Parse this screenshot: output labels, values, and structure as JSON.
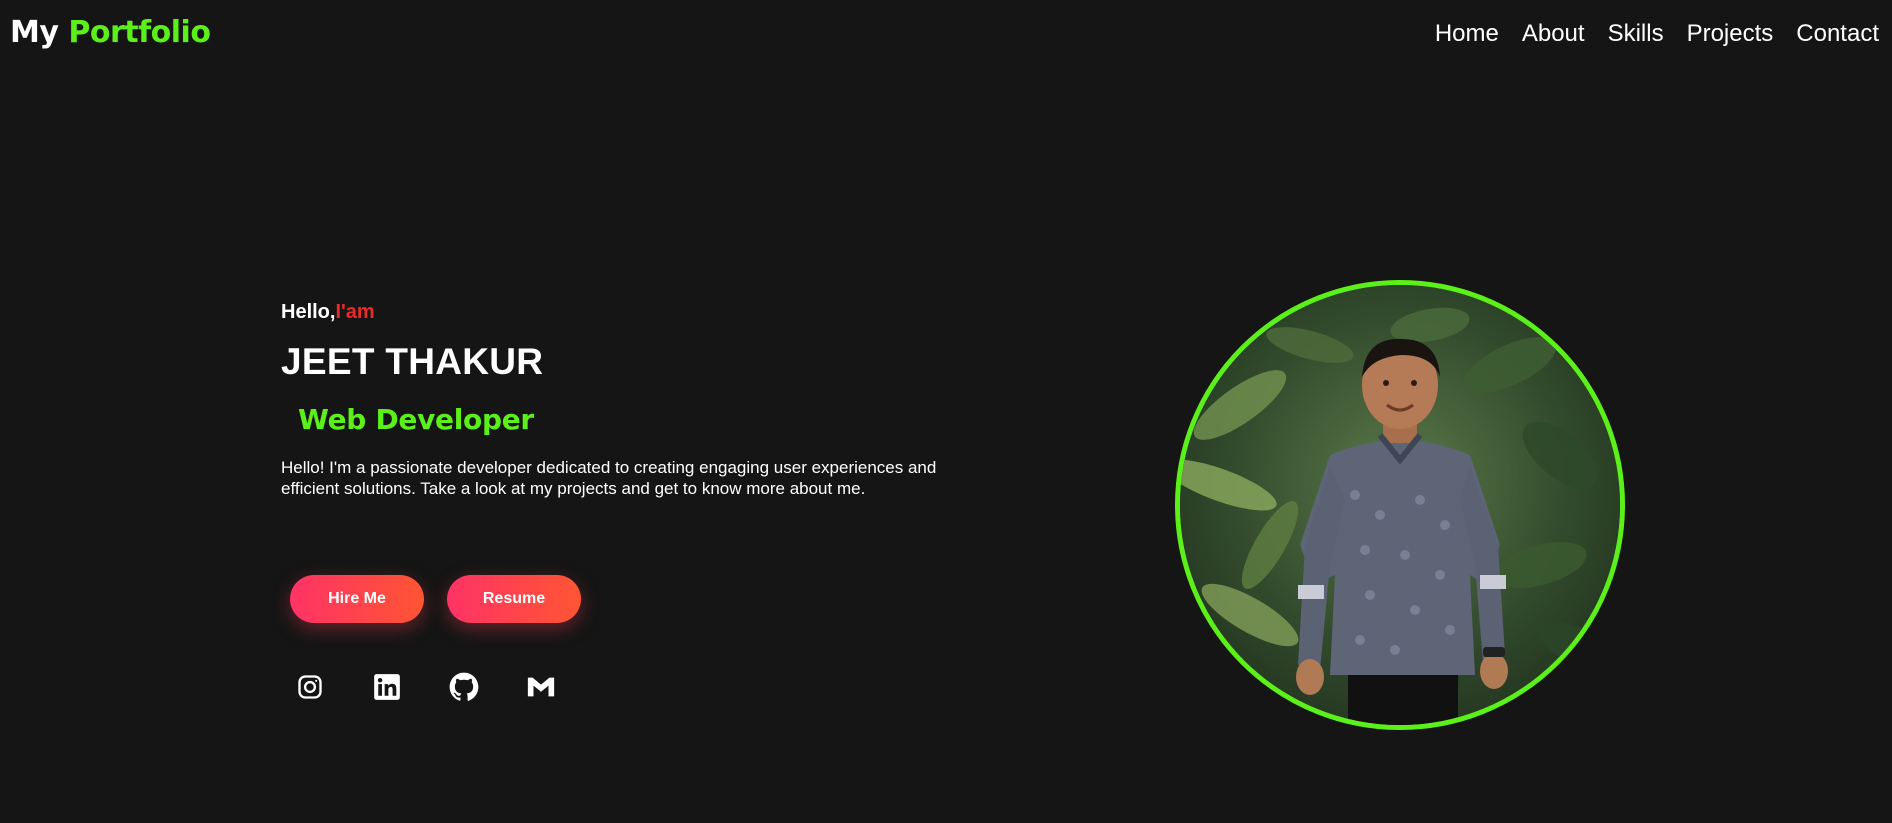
{
  "header": {
    "logo_prefix": "My",
    "logo_accent": "Portfolio",
    "nav": [
      {
        "label": "Home"
      },
      {
        "label": "About"
      },
      {
        "label": "Skills"
      },
      {
        "label": "Projects"
      },
      {
        "label": "Contact"
      }
    ]
  },
  "hero": {
    "greeting": "Hello,",
    "greeting_accent": "I'am",
    "name": "JEET THAKUR",
    "role": "Web Developer",
    "intro": "Hello! I'm a passionate developer dedicated to creating engaging user experiences and efficient solutions. Take a look at my projects and get to know more about me.",
    "buttons": {
      "hire": "Hire Me",
      "resume": "Resume"
    },
    "social": [
      {
        "icon": "instagram-icon"
      },
      {
        "icon": "linkedin-icon"
      },
      {
        "icon": "github-icon"
      },
      {
        "icon": "gmail-icon"
      }
    ]
  },
  "colors": {
    "background": "#151515",
    "accent_green": "#5cf01a",
    "accent_red": "#e82a2a",
    "button_gradient_start": "#ff3366",
    "button_gradient_end": "#ff5533"
  }
}
